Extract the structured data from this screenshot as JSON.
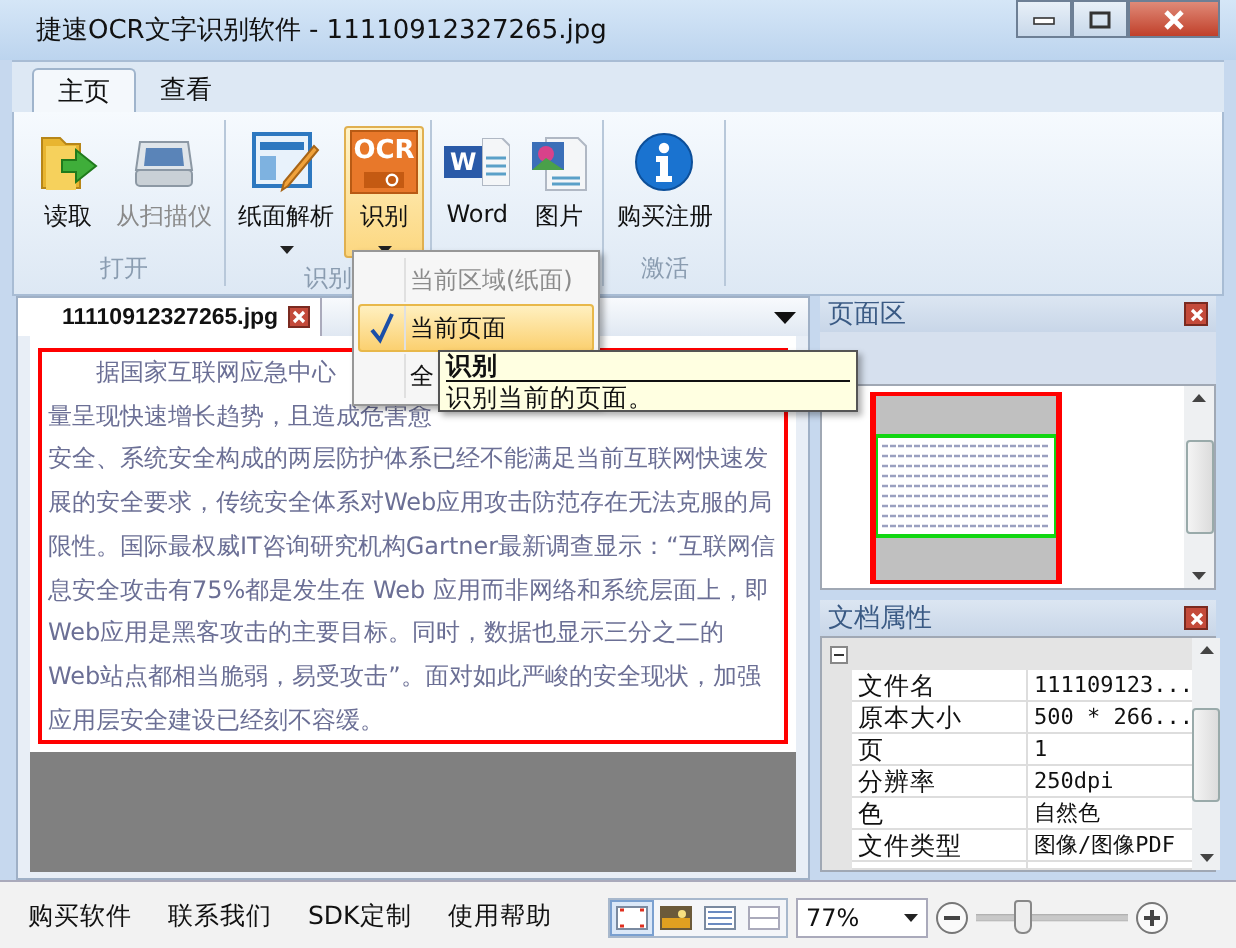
{
  "window": {
    "title": "捷速OCR文字识别软件 - 11110912327265.jpg"
  },
  "ribbon_tabs": [
    {
      "label": "主页",
      "selected": true
    },
    {
      "label": "查看",
      "selected": false
    }
  ],
  "ribbon_groups": [
    {
      "label": "打开",
      "buttons": [
        {
          "label": "读取",
          "disabled": false,
          "dropdown": false,
          "active": false
        },
        {
          "label": "从扫描仪",
          "disabled": true,
          "dropdown": false,
          "active": false
        }
      ]
    },
    {
      "label": "识别",
      "buttons": [
        {
          "label": "纸面解析",
          "disabled": false,
          "dropdown": true,
          "active": false
        },
        {
          "label": "识别",
          "disabled": false,
          "dropdown": true,
          "active": true,
          "badge": "OCR"
        }
      ]
    },
    {
      "buttons": [
        {
          "label": "Word",
          "disabled": false,
          "dropdown": false,
          "active": false,
          "badge": "W"
        },
        {
          "label": "图片",
          "disabled": false,
          "dropdown": false,
          "active": false
        }
      ]
    },
    {
      "label": "激活",
      "buttons": [
        {
          "label": "购买注册",
          "disabled": false,
          "dropdown": false,
          "active": false
        }
      ]
    }
  ],
  "menu": {
    "items": [
      {
        "label": "当前区域(纸面)",
        "disabled": true,
        "checked": false,
        "selected": false
      },
      {
        "label": "当前页面",
        "disabled": false,
        "checked": true,
        "selected": true
      },
      {
        "label": "全",
        "disabled": false,
        "checked": false,
        "selected": false
      }
    ]
  },
  "tooltip": {
    "title": "识别",
    "text": "识别当前的页面。"
  },
  "document": {
    "tab": "11110912327265.jpg",
    "lines": [
      "据国家互联网应急中心",
      "量呈现快速增长趋势，且造成危害愈",
      "安全、系统安全构成的两层防护体系已经不能满足当前互联网快速发",
      "展的安全要求，传统安全体系对Web应用攻击防范存在无法克服的局",
      "限性。国际最权威IT咨询研究机构Gartner最新调查显示：“互联网信",
      "息安全攻击有75%都是发生在 Web 应用而非网络和系统层面上，即",
      "Web应用是黑客攻击的主要目标。同时，数据也显示三分之二的",
      "Web站点都相当脆弱，易受攻击”。面对如此严峻的安全现状，加强",
      "应用层安全建设已经刻不容缓。"
    ]
  },
  "page_panel": {
    "title": "页面区"
  },
  "properties": {
    "title": "文档属性",
    "rows": [
      {
        "name": "文件名",
        "value": "111109123..."
      },
      {
        "name": "原本大小",
        "value": "500 * 266..."
      },
      {
        "name": "页",
        "value": "1"
      },
      {
        "name": "分辨率",
        "value": "250dpi"
      },
      {
        "name": "色",
        "value": "自然色"
      },
      {
        "name": "文件类型",
        "value": "图像/图像PDF"
      }
    ]
  },
  "status_bar": {
    "links": [
      "购买软件",
      "联系我们",
      "SDK定制",
      "使用帮助"
    ],
    "views": [
      {
        "selected": true
      },
      {
        "selected": false
      },
      {
        "selected": false
      },
      {
        "selected": false
      }
    ],
    "zoom": "77%",
    "zoom_slider": {
      "level": 0.3
    }
  }
}
